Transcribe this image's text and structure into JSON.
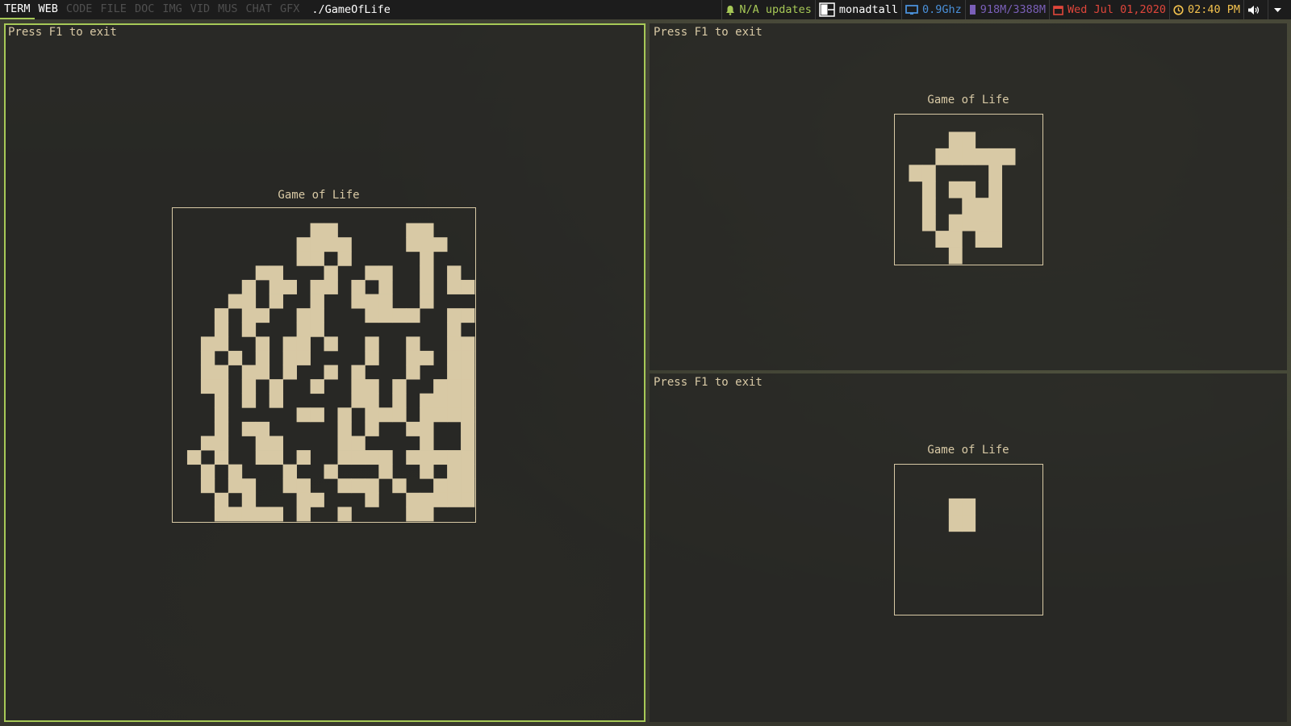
{
  "topbar": {
    "groups": [
      {
        "label": "TERM",
        "state": "active"
      },
      {
        "label": "WEB",
        "state": "occupied"
      },
      {
        "label": "CODE",
        "state": "empty"
      },
      {
        "label": "FILE",
        "state": "empty"
      },
      {
        "label": "DOC",
        "state": "empty"
      },
      {
        "label": "IMG",
        "state": "empty"
      },
      {
        "label": "VID",
        "state": "empty"
      },
      {
        "label": "MUS",
        "state": "empty"
      },
      {
        "label": "CHAT",
        "state": "empty"
      },
      {
        "label": "GFX",
        "state": "empty"
      }
    ],
    "window_name": "./GameOfLife",
    "widgets": {
      "updates": "N/A updates",
      "layout": "monadtall",
      "cpu": "0.9Ghz",
      "memory": "918M/3388M",
      "date": "Wed Jul 01,2020",
      "time": "02:40 PM"
    },
    "icons": {
      "updates": "bell-icon",
      "layout": "monadtall-layout-icon",
      "cpu": "monitor-icon",
      "memory": "memory-chip-icon",
      "date": "calendar-icon",
      "time": "clock-icon",
      "volume": "speaker-icon",
      "menu": "chevron-down-icon"
    }
  },
  "colors": {
    "accent": "#a7c957",
    "cell": "#d8c9a5",
    "bar_bg": "#1c1c1c",
    "updates": "#a7c957",
    "cpu": "#4a90d9",
    "memory": "#7a5fb8",
    "date": "#e0463b",
    "time": "#f2c14e"
  },
  "windows": [
    {
      "id": "left",
      "focused": true,
      "hint": "Press F1 to exit",
      "title": "Game of Life",
      "grid": [
        "......................",
        "..........##.....##...",
        ".........####....###..",
        ".........##.#.....#...",
        "......##...#..##..#.#.",
        ".....#.##.##.#.#..#.##",
        "....##.#..#..###..#...",
        "...#.##..##...####..##",
        "...#.#...##.........#.",
        "..##..#.##.#..#..#..##",
        "..#.#.#.##....#..##.##",
        "..##.##.#..#.#...#..##",
        "..##.#.#..#..##.#..###",
        "...#.#.#.....##.#.####",
        "...#.....##.#.###.####",
        "...#.##.....#.#..##..#",
        "..##..##....##....#..#",
        ".#.#..##.#..####.#####",
        "..#.#...#..#...#..#.##",
        "..#.##..##..###.#..###",
        "...#.#...##...#..#####",
        "...#####.#..#....##..."
      ]
    },
    {
      "id": "right-top",
      "focused": false,
      "hint": "Press F1 to exit",
      "title": "Game of Life",
      "grid": [
        "...........",
        "....##.....",
        "...######..",
        ".##....#...",
        "..#.##.#...",
        "..#..###...",
        "..#.####...",
        "...##.##...",
        "....#......"
      ]
    },
    {
      "id": "right-bottom",
      "focused": false,
      "hint": "Press F1 to exit",
      "title": "Game of Life",
      "grid": [
        "...........",
        "...........",
        "....##.....",
        "....##.....",
        "...........",
        "...........",
        "...........",
        "...........",
        "..........."
      ]
    }
  ]
}
